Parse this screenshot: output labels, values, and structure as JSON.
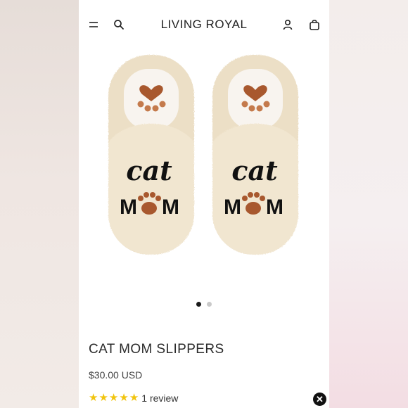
{
  "header": {
    "brand": "LIVING ROYAL",
    "icons": [
      "menu-icon",
      "search-icon",
      "account-icon",
      "cart-icon"
    ]
  },
  "product": {
    "image_text": {
      "line1": "cat",
      "line2_left": "M",
      "line2_right": "M"
    },
    "title": "CAT MOM SLIPPERS",
    "price": "$30.00 USD",
    "rating": {
      "stars": 5,
      "max": 5,
      "review_text": "1 review"
    }
  },
  "carousel": {
    "total": 2,
    "active": 1
  },
  "colors": {
    "accent_star": "#f1c40f",
    "slipper": "#efe3cc",
    "paw": "#a8582e",
    "dark": "#1a1a1a"
  },
  "overlay": {
    "close_icon": "close-icon"
  }
}
